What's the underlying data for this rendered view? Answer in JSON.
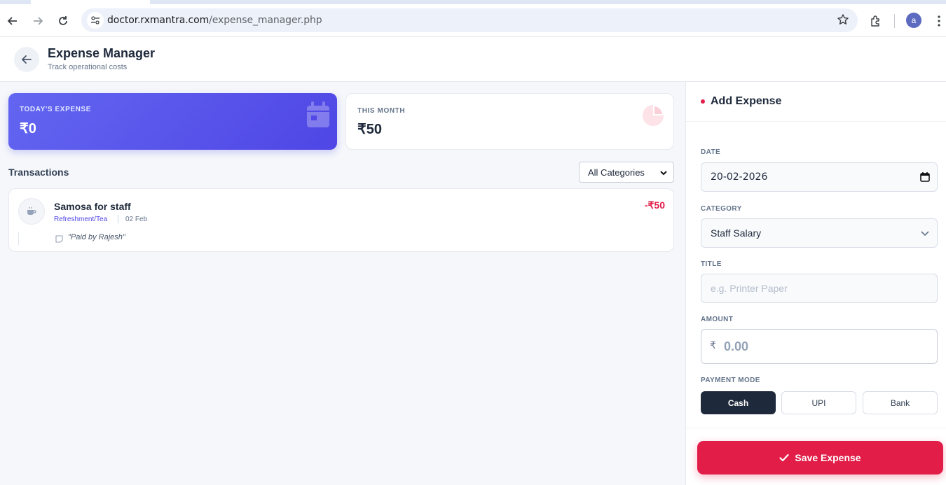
{
  "browser": {
    "url_domain": "doctor.rxmantra.com",
    "url_path": "/expense_manager.php",
    "profile_initial": "a"
  },
  "header": {
    "title": "Expense Manager",
    "subtitle": "Track operational costs"
  },
  "stats": {
    "today_label": "TODAY'S EXPENSE",
    "today_value": "₹0",
    "month_label": "THIS MONTH",
    "month_value": "₹50"
  },
  "transactions": {
    "title": "Transactions",
    "filter_value": "All Categories",
    "items": [
      {
        "title": "Samosa for staff",
        "category": "Refreshment/Tea",
        "date": "02 Feb",
        "note": "\"Paid by Rajesh\"",
        "amount": "-₹50"
      }
    ]
  },
  "form": {
    "title": "Add Expense",
    "date_label": "DATE",
    "date_value": "20-02-2026",
    "category_label": "CATEGORY",
    "category_value": "Staff Salary",
    "title_label": "TITLE",
    "title_placeholder": "e.g. Printer Paper",
    "amount_label": "AMOUNT",
    "currency_symbol": "₹",
    "amount_placeholder": "0.00",
    "payment_label": "PAYMENT MODE",
    "payment_modes": [
      "Cash",
      "UPI",
      "Bank"
    ],
    "payment_selected": "Cash",
    "save_label": "Save Expense"
  },
  "colors": {
    "accent": "#4f46e5",
    "danger": "#e11d48",
    "dark": "#1e293b"
  }
}
